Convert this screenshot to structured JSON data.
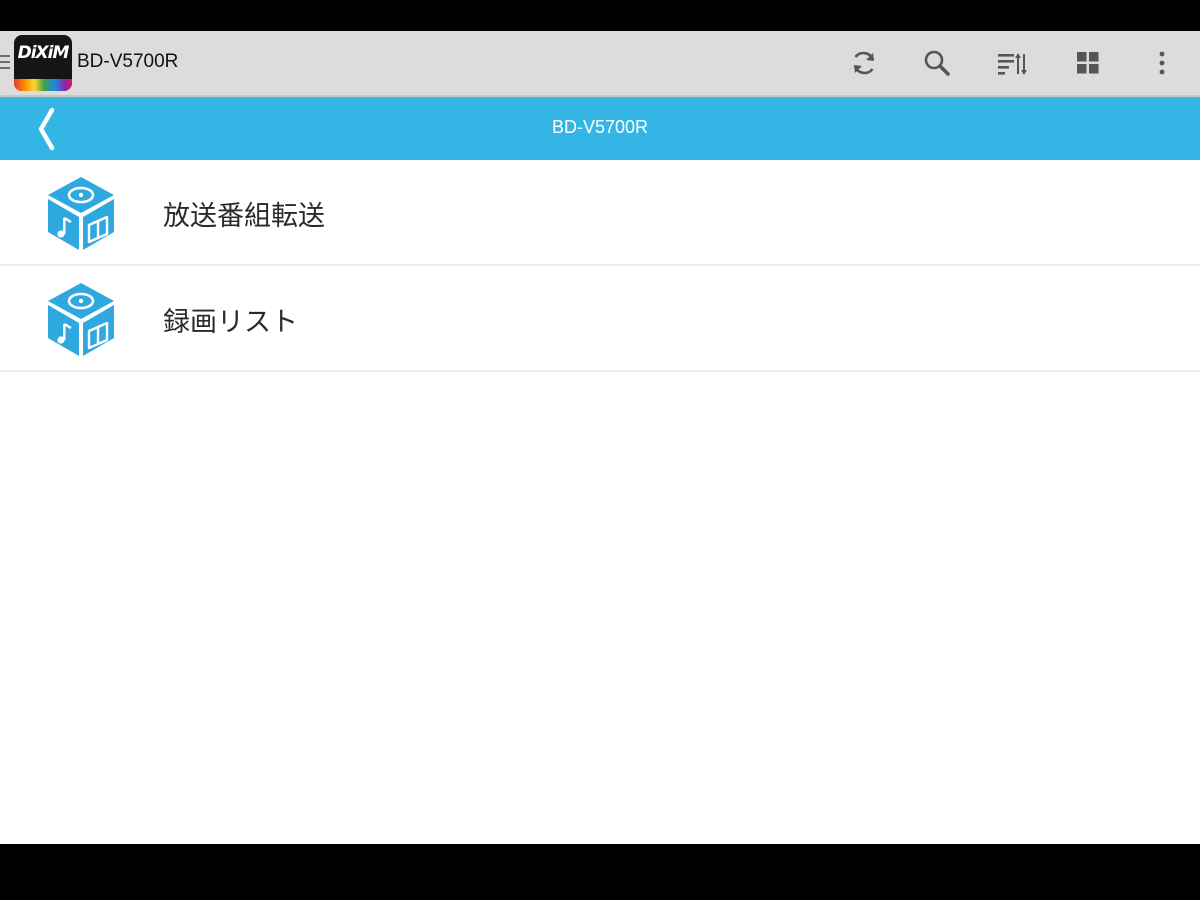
{
  "action_bar": {
    "title": "BD-V5700R",
    "logo_text": "DiXiM",
    "icons": [
      "drawer-icon",
      "refresh-icon",
      "search-icon",
      "sort-icon",
      "grid-view-icon",
      "overflow-menu-icon"
    ]
  },
  "header": {
    "title": "BD-V5700R",
    "back_icon": "chevron-left-icon"
  },
  "list": {
    "items": [
      {
        "label": "放送番組転送",
        "icon": "media-cube-icon"
      },
      {
        "label": "録画リスト",
        "icon": "media-cube-icon"
      }
    ]
  },
  "colors": {
    "accent": "#33b5e5",
    "icon_blue": "#2fa8e0",
    "action_bar_bg": "#dcdcdc",
    "text": "#2a2a2a"
  }
}
